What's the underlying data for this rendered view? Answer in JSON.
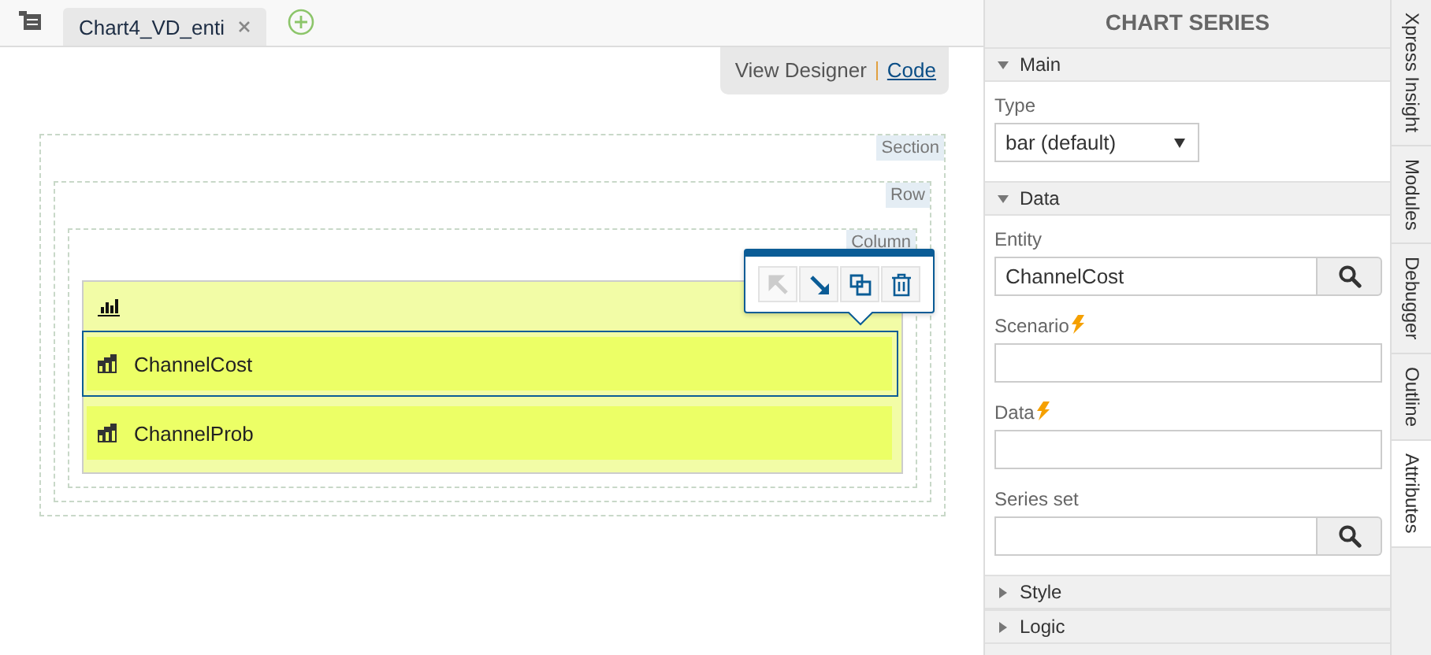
{
  "editor_tabs": [
    {
      "label": "Chart4_VD_enti",
      "selected": true
    }
  ],
  "view_switch": [
    {
      "label": "View Designer",
      "selected": true
    },
    {
      "label": "Code",
      "selected": false
    }
  ],
  "canvas": {
    "section_label": "Section",
    "row_label": "Row",
    "column_label": "Column",
    "toolbar": [
      {
        "kind": "move-up",
        "disabled": true
      },
      {
        "kind": "move-down",
        "disabled": false
      },
      {
        "kind": "copy",
        "disabled": false
      },
      {
        "kind": "delete",
        "disabled": false
      }
    ],
    "series": [
      {
        "label": "ChannelCost",
        "selected": true
      },
      {
        "label": "ChannelProb",
        "selected": false
      }
    ]
  },
  "panel": {
    "title": "CHART SERIES",
    "groups": [
      {
        "title": "Main",
        "expanded": true,
        "fields": [
          {
            "kind": "select",
            "label": "Type",
            "value": "bar (default)",
            "dynamic": false
          }
        ]
      },
      {
        "title": "Data",
        "expanded": true,
        "fields": [
          {
            "kind": "lookup",
            "label": "Entity",
            "value": "ChannelCost",
            "dynamic": false
          },
          {
            "kind": "text",
            "label": "Scenario",
            "dynamic": true
          },
          {
            "kind": "text",
            "label": "Data",
            "dynamic": true
          },
          {
            "kind": "lookup",
            "label": "Series set",
            "dynamic": false
          }
        ]
      },
      {
        "title": "Style",
        "expanded": false
      },
      {
        "title": "Logic",
        "expanded": false
      }
    ]
  },
  "side_tabs": [
    {
      "label": "Xpress Insight",
      "selected": false
    },
    {
      "label": "Modules",
      "selected": false
    },
    {
      "label": "Debugger",
      "selected": false
    },
    {
      "label": "Outline",
      "selected": false
    },
    {
      "label": "Attributes",
      "selected": true
    }
  ]
}
